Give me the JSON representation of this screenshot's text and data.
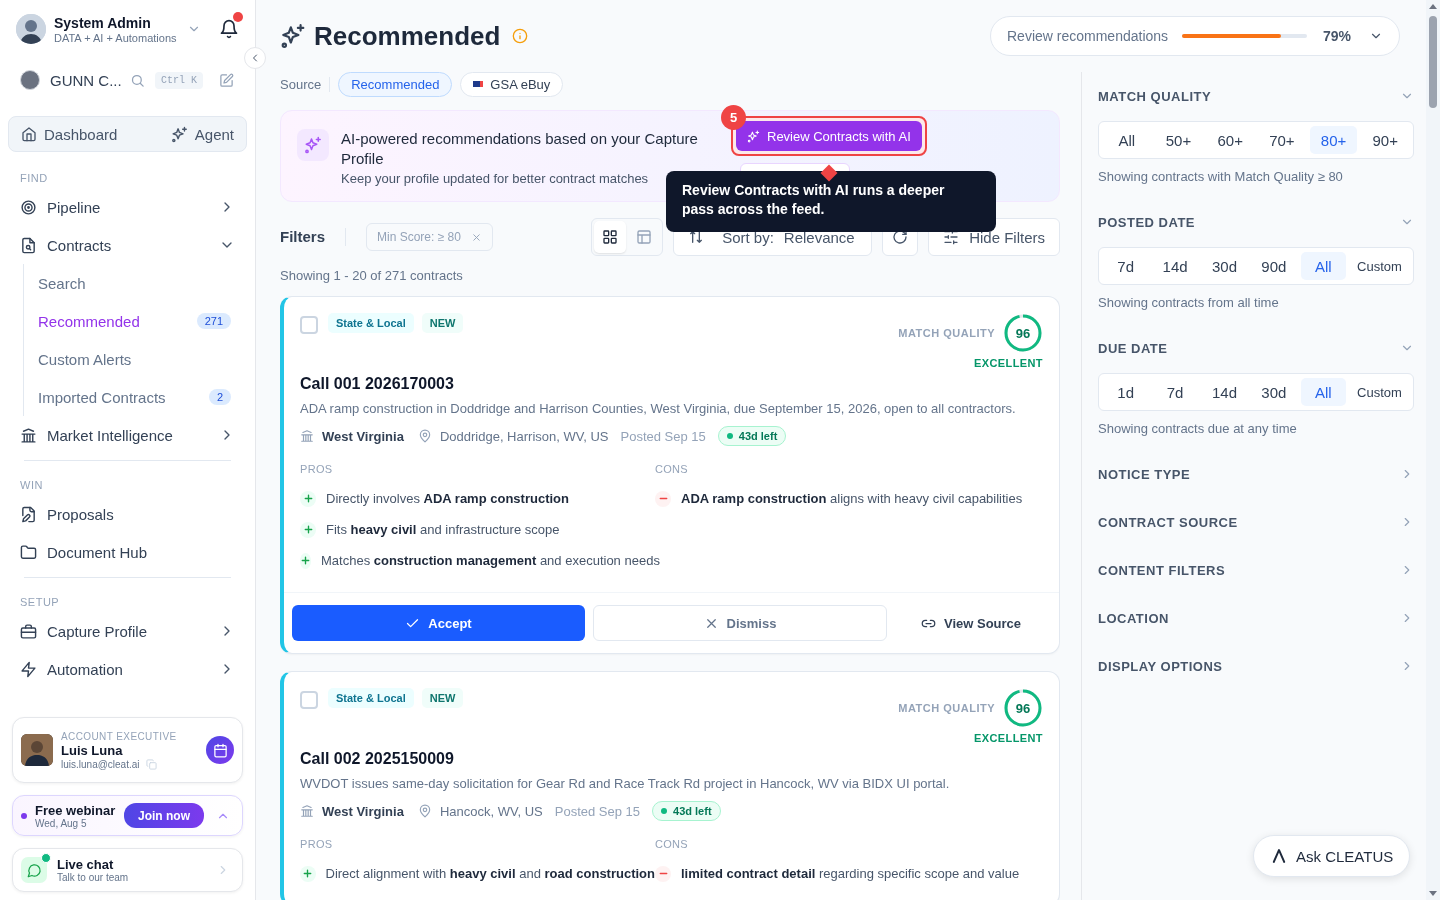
{
  "user": {
    "name": "System Admin",
    "subtitle": "DATA + AI + Automations"
  },
  "org": {
    "name": "GUNN C...",
    "shortcut": "Ctrl K"
  },
  "quick_nav": [
    {
      "label": "Dashboard"
    },
    {
      "label": "Agent"
    }
  ],
  "nav_sections": [
    {
      "label": "FIND",
      "items": [
        {
          "label": "Pipeline",
          "kind": "expand",
          "expanded": false
        },
        {
          "label": "Contracts",
          "kind": "expand",
          "expanded": true,
          "children": [
            {
              "label": "Search",
              "selected": false
            },
            {
              "label": "Recommended",
              "selected": true,
              "badge": "271"
            },
            {
              "label": "Custom Alerts",
              "selected": false
            },
            {
              "label": "Imported Contracts",
              "selected": false,
              "badge": "2"
            }
          ]
        },
        {
          "label": "Market Intelligence",
          "kind": "expand",
          "expanded": false
        }
      ]
    },
    {
      "label": "WIN",
      "items": [
        {
          "label": "Proposals",
          "kind": "link"
        },
        {
          "label": "Document Hub",
          "kind": "link"
        }
      ]
    },
    {
      "label": "SETUP",
      "items": [
        {
          "label": "Capture Profile",
          "kind": "expand",
          "expanded": false
        },
        {
          "label": "Automation",
          "kind": "expand",
          "expanded": false
        }
      ]
    }
  ],
  "account_executive": {
    "role": "ACCOUNT EXECUTIVE",
    "name": "Luis Luna",
    "email": "luis.luna@cleat.ai"
  },
  "webinar": {
    "title": "Free webinar",
    "date": "Wed, Aug 5",
    "button": "Join now"
  },
  "live_chat": {
    "title": "Live chat",
    "subtitle": "Talk to our team"
  },
  "page": {
    "title": "Recommended"
  },
  "review_progress": {
    "label": "Review recommendations",
    "level": 0.79,
    "reading": "79%"
  },
  "source": {
    "label": "Source",
    "chips": [
      {
        "label": "Recommended",
        "selected": true
      },
      {
        "label": "GSA eBuy",
        "selected": false
      }
    ]
  },
  "banner": {
    "title": "AI-powered recommendations based on your Capture Profile",
    "subtitle": "Keep your profile updated for better contract matches",
    "button": "Review Contracts with AI",
    "step": "5",
    "tooltip": "Review Contracts with AI runs a deeper pass across the feed."
  },
  "filters": {
    "label": "Filters",
    "chips": [
      "Min Score: ≥ 80"
    ],
    "views": [
      {
        "kind": "grid",
        "selected": true
      },
      {
        "kind": "table",
        "selected": false
      }
    ],
    "sort_label": "Sort by:",
    "sort_value": "Relevance",
    "hide_button": "Hide Filters",
    "showing": "Showing 1 - 20 of 271 contracts"
  },
  "cards": [
    {
      "checked": false,
      "tags": [
        "State & Local",
        "NEW"
      ],
      "quality_label": "MATCH QUALITY",
      "score": "96",
      "level": 0.96,
      "rating": "EXCELLENT",
      "title": "Call 001 2026170003",
      "description": "ADA ramp construction in Doddridge and Harrison Counties, West Virginia, due September 15, 2026, open to all contractors.",
      "agency": "West Virginia",
      "location": "Doddridge, Harrison, WV, US",
      "posted": "Posted Sep 15",
      "remaining": "43d left",
      "pros_label": "PROS",
      "pros": [
        "Directly involves **ADA ramp construction**",
        "Fits **heavy civil** and infrastructure scope",
        "Matches **construction management** and execution needs"
      ],
      "cons_label": "CONS",
      "cons": [
        "**ADA ramp construction** aligns with heavy civil capabilities"
      ],
      "actions": [
        {
          "kind": "accept",
          "label": "Accept"
        },
        {
          "kind": "dismiss",
          "label": "Dismiss"
        },
        {
          "kind": "source",
          "label": "View Source"
        }
      ]
    },
    {
      "checked": false,
      "tags": [
        "State & Local",
        "NEW"
      ],
      "quality_label": "MATCH QUALITY",
      "score": "96",
      "level": 0.96,
      "rating": "EXCELLENT",
      "title": "Call 002 2025150009",
      "description": "WVDOT issues same-day solicitation for Gear Rd and Race Track Rd project in Hancock, WV via BIDX UI portal.",
      "agency": "West Virginia",
      "location": "Hancock, WV, US",
      "posted": "Posted Sep 15",
      "remaining": "43d left",
      "pros_label": "PROS",
      "pros": [
        "Direct alignment with **heavy civil** and **road construction**"
      ],
      "cons_label": "CONS",
      "cons": [
        "**limited contract detail** regarding specific scope and value"
      ]
    }
  ],
  "filter_panel": [
    {
      "title": "MATCH QUALITY",
      "expanded": true,
      "options": [
        {
          "label": "All",
          "kind": "preset",
          "selected": false
        },
        {
          "label": "50+",
          "kind": "preset",
          "selected": false
        },
        {
          "label": "60+",
          "kind": "preset",
          "selected": false
        },
        {
          "label": "70+",
          "kind": "preset",
          "selected": false
        },
        {
          "label": "80+",
          "kind": "preset",
          "selected": true
        },
        {
          "label": "90+",
          "kind": "preset",
          "selected": false
        }
      ],
      "note": "Showing contracts with Match Quality ≥ 80"
    },
    {
      "title": "POSTED DATE",
      "expanded": true,
      "options": [
        {
          "label": "7d",
          "kind": "preset",
          "selected": false
        },
        {
          "label": "14d",
          "kind": "preset",
          "selected": false
        },
        {
          "label": "30d",
          "kind": "preset",
          "selected": false
        },
        {
          "label": "90d",
          "kind": "preset",
          "selected": false
        },
        {
          "label": "All",
          "kind": "preset",
          "selected": true
        },
        {
          "label": "Custom",
          "kind": "custom",
          "selected": false
        }
      ],
      "note": "Showing contracts from all time"
    },
    {
      "title": "DUE DATE",
      "expanded": true,
      "options": [
        {
          "label": "1d",
          "kind": "preset",
          "selected": false
        },
        {
          "label": "7d",
          "kind": "preset",
          "selected": false
        },
        {
          "label": "14d",
          "kind": "preset",
          "selected": false
        },
        {
          "label": "30d",
          "kind": "preset",
          "selected": false
        },
        {
          "label": "All",
          "kind": "preset",
          "selected": true
        },
        {
          "label": "Custom",
          "kind": "custom",
          "selected": false
        }
      ],
      "note": "Showing contracts due at any time"
    },
    {
      "title": "NOTICE TYPE",
      "expanded": false
    },
    {
      "title": "CONTRACT SOURCE",
      "expanded": false
    },
    {
      "title": "CONTENT FILTERS",
      "expanded": false
    },
    {
      "title": "LOCATION",
      "expanded": false
    },
    {
      "title": "DISPLAY OPTIONS",
      "expanded": false
    }
  ],
  "ask_button": "Ask CLEATUS"
}
